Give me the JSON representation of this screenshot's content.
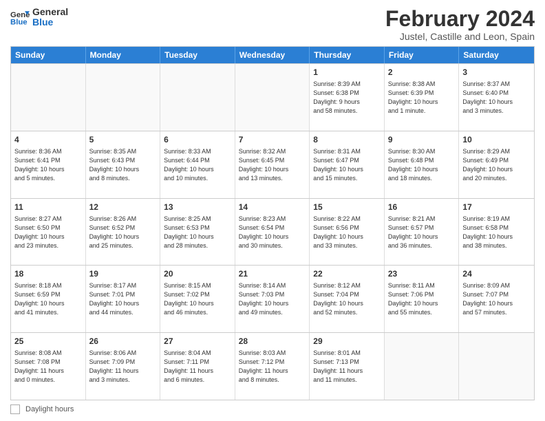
{
  "logo": {
    "general": "General",
    "blue": "Blue"
  },
  "header": {
    "month": "February 2024",
    "location": "Justel, Castille and Leon, Spain"
  },
  "weekdays": [
    "Sunday",
    "Monday",
    "Tuesday",
    "Wednesday",
    "Thursday",
    "Friday",
    "Saturday"
  ],
  "weeks": [
    [
      {
        "day": "",
        "info": "",
        "empty": true
      },
      {
        "day": "",
        "info": "",
        "empty": true
      },
      {
        "day": "",
        "info": "",
        "empty": true
      },
      {
        "day": "",
        "info": "",
        "empty": true
      },
      {
        "day": "1",
        "info": "Sunrise: 8:39 AM\nSunset: 6:38 PM\nDaylight: 9 hours\nand 58 minutes.",
        "empty": false
      },
      {
        "day": "2",
        "info": "Sunrise: 8:38 AM\nSunset: 6:39 PM\nDaylight: 10 hours\nand 1 minute.",
        "empty": false
      },
      {
        "day": "3",
        "info": "Sunrise: 8:37 AM\nSunset: 6:40 PM\nDaylight: 10 hours\nand 3 minutes.",
        "empty": false
      }
    ],
    [
      {
        "day": "4",
        "info": "Sunrise: 8:36 AM\nSunset: 6:41 PM\nDaylight: 10 hours\nand 5 minutes.",
        "empty": false
      },
      {
        "day": "5",
        "info": "Sunrise: 8:35 AM\nSunset: 6:43 PM\nDaylight: 10 hours\nand 8 minutes.",
        "empty": false
      },
      {
        "day": "6",
        "info": "Sunrise: 8:33 AM\nSunset: 6:44 PM\nDaylight: 10 hours\nand 10 minutes.",
        "empty": false
      },
      {
        "day": "7",
        "info": "Sunrise: 8:32 AM\nSunset: 6:45 PM\nDaylight: 10 hours\nand 13 minutes.",
        "empty": false
      },
      {
        "day": "8",
        "info": "Sunrise: 8:31 AM\nSunset: 6:47 PM\nDaylight: 10 hours\nand 15 minutes.",
        "empty": false
      },
      {
        "day": "9",
        "info": "Sunrise: 8:30 AM\nSunset: 6:48 PM\nDaylight: 10 hours\nand 18 minutes.",
        "empty": false
      },
      {
        "day": "10",
        "info": "Sunrise: 8:29 AM\nSunset: 6:49 PM\nDaylight: 10 hours\nand 20 minutes.",
        "empty": false
      }
    ],
    [
      {
        "day": "11",
        "info": "Sunrise: 8:27 AM\nSunset: 6:50 PM\nDaylight: 10 hours\nand 23 minutes.",
        "empty": false
      },
      {
        "day": "12",
        "info": "Sunrise: 8:26 AM\nSunset: 6:52 PM\nDaylight: 10 hours\nand 25 minutes.",
        "empty": false
      },
      {
        "day": "13",
        "info": "Sunrise: 8:25 AM\nSunset: 6:53 PM\nDaylight: 10 hours\nand 28 minutes.",
        "empty": false
      },
      {
        "day": "14",
        "info": "Sunrise: 8:23 AM\nSunset: 6:54 PM\nDaylight: 10 hours\nand 30 minutes.",
        "empty": false
      },
      {
        "day": "15",
        "info": "Sunrise: 8:22 AM\nSunset: 6:56 PM\nDaylight: 10 hours\nand 33 minutes.",
        "empty": false
      },
      {
        "day": "16",
        "info": "Sunrise: 8:21 AM\nSunset: 6:57 PM\nDaylight: 10 hours\nand 36 minutes.",
        "empty": false
      },
      {
        "day": "17",
        "info": "Sunrise: 8:19 AM\nSunset: 6:58 PM\nDaylight: 10 hours\nand 38 minutes.",
        "empty": false
      }
    ],
    [
      {
        "day": "18",
        "info": "Sunrise: 8:18 AM\nSunset: 6:59 PM\nDaylight: 10 hours\nand 41 minutes.",
        "empty": false
      },
      {
        "day": "19",
        "info": "Sunrise: 8:17 AM\nSunset: 7:01 PM\nDaylight: 10 hours\nand 44 minutes.",
        "empty": false
      },
      {
        "day": "20",
        "info": "Sunrise: 8:15 AM\nSunset: 7:02 PM\nDaylight: 10 hours\nand 46 minutes.",
        "empty": false
      },
      {
        "day": "21",
        "info": "Sunrise: 8:14 AM\nSunset: 7:03 PM\nDaylight: 10 hours\nand 49 minutes.",
        "empty": false
      },
      {
        "day": "22",
        "info": "Sunrise: 8:12 AM\nSunset: 7:04 PM\nDaylight: 10 hours\nand 52 minutes.",
        "empty": false
      },
      {
        "day": "23",
        "info": "Sunrise: 8:11 AM\nSunset: 7:06 PM\nDaylight: 10 hours\nand 55 minutes.",
        "empty": false
      },
      {
        "day": "24",
        "info": "Sunrise: 8:09 AM\nSunset: 7:07 PM\nDaylight: 10 hours\nand 57 minutes.",
        "empty": false
      }
    ],
    [
      {
        "day": "25",
        "info": "Sunrise: 8:08 AM\nSunset: 7:08 PM\nDaylight: 11 hours\nand 0 minutes.",
        "empty": false
      },
      {
        "day": "26",
        "info": "Sunrise: 8:06 AM\nSunset: 7:09 PM\nDaylight: 11 hours\nand 3 minutes.",
        "empty": false
      },
      {
        "day": "27",
        "info": "Sunrise: 8:04 AM\nSunset: 7:11 PM\nDaylight: 11 hours\nand 6 minutes.",
        "empty": false
      },
      {
        "day": "28",
        "info": "Sunrise: 8:03 AM\nSunset: 7:12 PM\nDaylight: 11 hours\nand 8 minutes.",
        "empty": false
      },
      {
        "day": "29",
        "info": "Sunrise: 8:01 AM\nSunset: 7:13 PM\nDaylight: 11 hours\nand 11 minutes.",
        "empty": false
      },
      {
        "day": "",
        "info": "",
        "empty": true
      },
      {
        "day": "",
        "info": "",
        "empty": true
      }
    ]
  ],
  "footer": {
    "legend_label": "Daylight hours"
  }
}
